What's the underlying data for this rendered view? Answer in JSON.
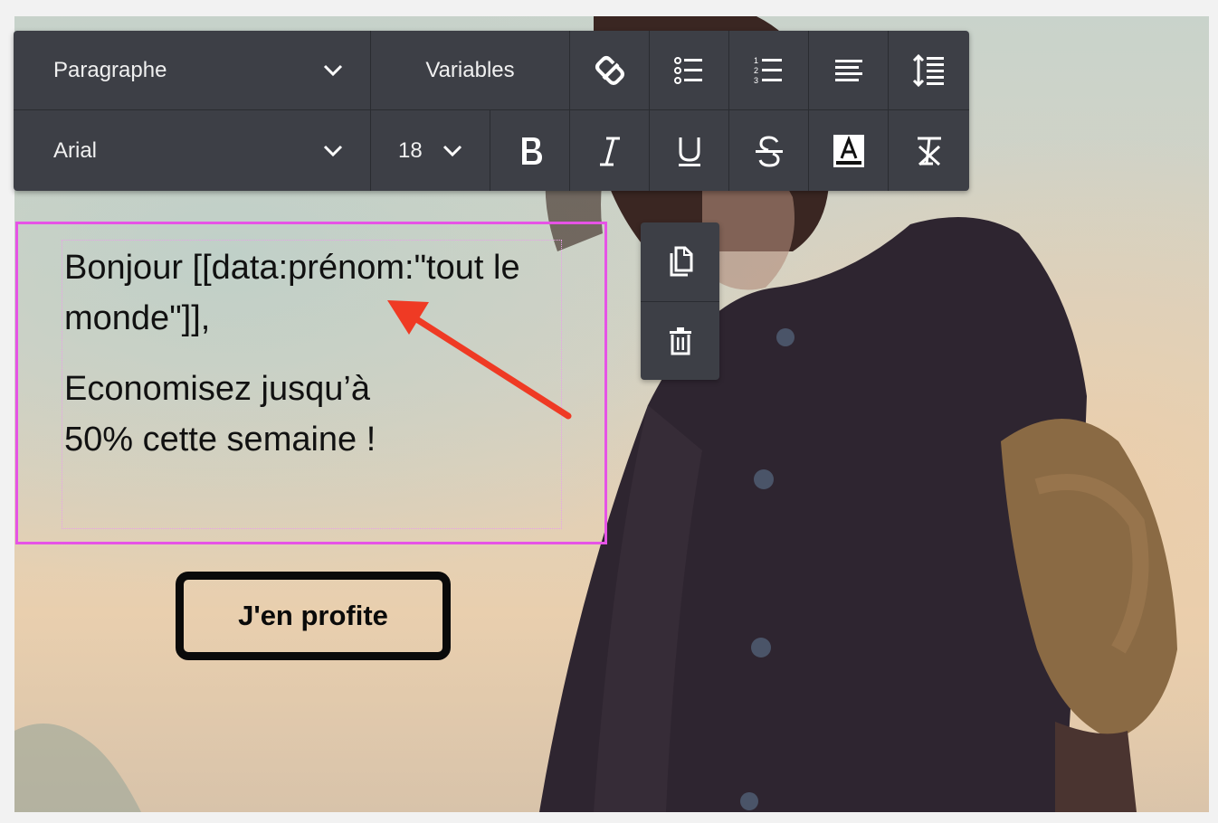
{
  "toolbar": {
    "block_format": "Paragraphe",
    "variables_label": "Variables",
    "font_family": "Arial",
    "font_size": "18"
  },
  "content": {
    "paragraph_1": "Bonjour [[data:prénom:\"tout le monde\"]],",
    "paragraph_2": "Economisez jusqu’à 50% cette semaine !"
  },
  "cta": {
    "label": "J'en profite"
  },
  "colors": {
    "toolbar_bg": "#3d3f46",
    "selection_border": "#e653e6",
    "annotation_arrow": "#ef3a24"
  },
  "icons": [
    "chevron-down-icon",
    "unlink-icon",
    "bulleted-list-icon",
    "numbered-list-icon",
    "align-left-icon",
    "line-height-icon",
    "bold-icon",
    "italic-icon",
    "underline-icon",
    "strikethrough-icon",
    "text-color-icon",
    "clear-format-icon",
    "duplicate-icon",
    "trash-icon"
  ]
}
